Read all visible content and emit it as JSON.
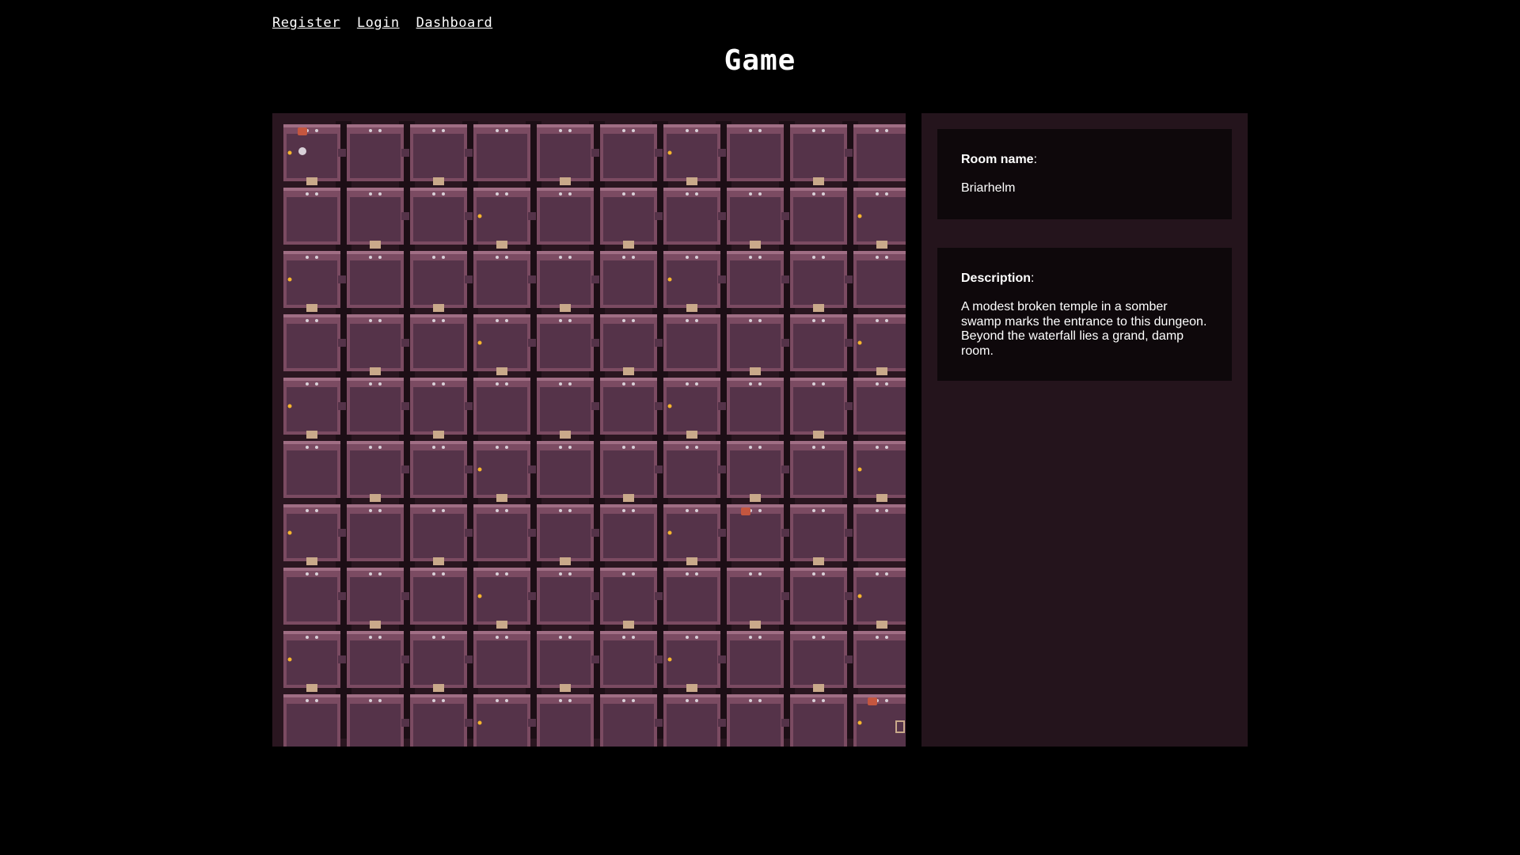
{
  "nav": {
    "links": [
      {
        "label": "Register"
      },
      {
        "label": "Login"
      },
      {
        "label": "Dashboard"
      }
    ]
  },
  "page": {
    "title": "Game"
  },
  "map": {
    "cols": 10,
    "rows": 10,
    "colors": {
      "frame": "#2a1620",
      "floor": "#553349",
      "wall": "#7b4b62",
      "wall_light": "#a06e84",
      "void": "#1c0e15",
      "door": "#c9a98a",
      "torch": "#f5b52e",
      "chest": "#c4563f",
      "skull": "#d8d0d8"
    },
    "items": [
      {
        "type": "chest",
        "col": 0,
        "row": 0
      },
      {
        "type": "player",
        "col": 0,
        "row": 0
      },
      {
        "type": "chest",
        "col": 9,
        "row": 9
      },
      {
        "type": "ladder",
        "col": 9,
        "row": 9
      },
      {
        "type": "chest",
        "col": 7,
        "row": 6
      }
    ]
  },
  "room": {
    "name_label": "Room name",
    "name_value": "Briarhelm"
  },
  "description": {
    "label": "Description",
    "text": "A modest broken temple in a somber swamp marks the entrance to this dungeon. Beyond the waterfall lies a grand, damp room."
  }
}
